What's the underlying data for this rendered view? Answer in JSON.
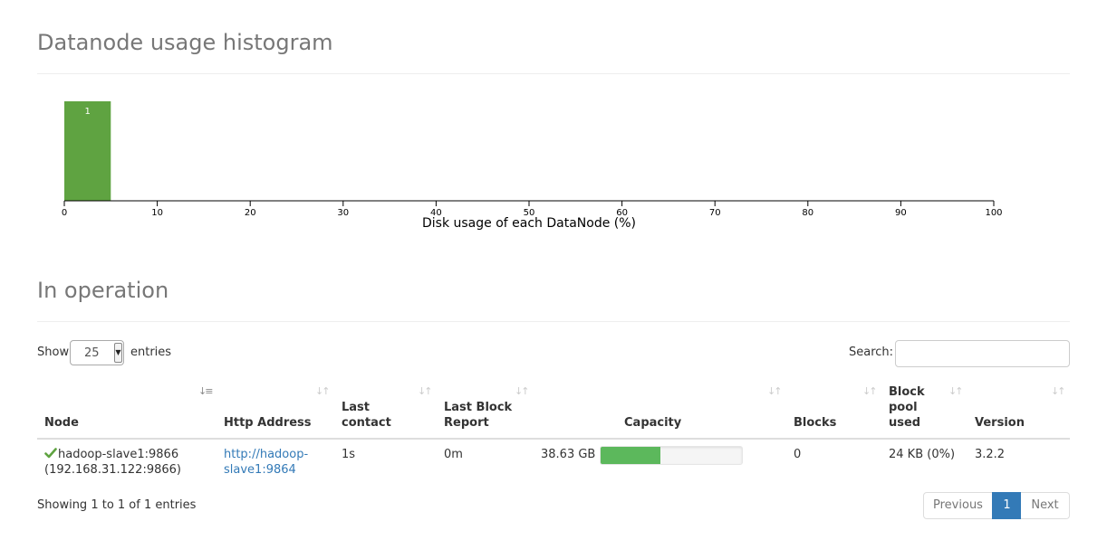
{
  "histogram_section": {
    "title": "Datanode usage histogram"
  },
  "chart_data": {
    "type": "bar",
    "title": "",
    "xlabel": "Disk usage of each DataNode (%)",
    "ylabel": "",
    "xlim": [
      0,
      100
    ],
    "x_ticks": [
      "0",
      "10",
      "20",
      "30",
      "40",
      "50",
      "60",
      "70",
      "80",
      "90",
      "100"
    ],
    "bins": [
      {
        "x0": 0,
        "x1": 5,
        "count": 1,
        "label": "1"
      }
    ],
    "colors": {
      "bar": "#5fa341",
      "bar_label": "#ffffff"
    }
  },
  "operation_section": {
    "title": "In operation"
  },
  "length_menu": {
    "show_label": "Show",
    "value": "25",
    "entries_label": "entries"
  },
  "search": {
    "label": "Search:",
    "placeholder": "",
    "value": ""
  },
  "table": {
    "headers": {
      "node": "Node",
      "http": "Http Address",
      "last_contact_1": "Last",
      "last_contact_2": "contact",
      "last_block_1": "Last Block",
      "last_block_2": "Report",
      "capacity": "Capacity",
      "blocks": "Blocks",
      "pool_1": "Block",
      "pool_2": "pool",
      "pool_3": "used",
      "version": "Version"
    },
    "sort_icons": {
      "sorted_asc": "↓≡",
      "sortable": "↓↑"
    },
    "rows": [
      {
        "status_icon": "check-icon",
        "node_name": "hadoop-slave1:9866",
        "node_ip": "(192.168.31.122:9866)",
        "http_line1": "http://hadoop-",
        "http_line2": "slave1:9864",
        "last_contact": "1s",
        "last_block_report": "0m",
        "capacity": "38.63 GB",
        "capacity_used_fraction": 0.42,
        "blocks": "0",
        "block_pool_used": "24 KB (0%)",
        "version": "3.2.2"
      }
    ]
  },
  "footer": {
    "info": "Showing 1 to 1 of 1 entries",
    "previous": "Previous",
    "current_page": "1",
    "next": "Next"
  },
  "colors": {
    "progress_fill": "#5cb85c",
    "link": "#337ab7",
    "check": "#5fa341",
    "pager_active": "#337ab7"
  }
}
